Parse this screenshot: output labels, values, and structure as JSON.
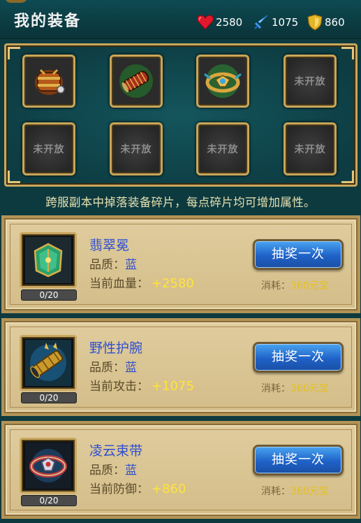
{
  "header": {
    "title": "我的装备",
    "stats": {
      "hp": "2580",
      "attack": "1075",
      "defense": "860"
    }
  },
  "equip_panel": {
    "slots": [
      {
        "state": "equipped",
        "icon": "chest-armor-icon"
      },
      {
        "state": "equipped",
        "icon": "bracer-icon"
      },
      {
        "state": "equipped",
        "icon": "belt-icon"
      },
      {
        "state": "locked",
        "label": "未开放"
      },
      {
        "state": "locked",
        "label": "未开放"
      },
      {
        "state": "locked",
        "label": "未开放"
      },
      {
        "state": "locked",
        "label": "未开放"
      },
      {
        "state": "locked",
        "label": "未开放"
      }
    ]
  },
  "info_text": "跨服副本中掉落装备碎片，每点碎片均可增加属性。",
  "cards": [
    {
      "name": "翡翠冕",
      "quality_label": "品质：",
      "quality_value": "蓝",
      "stat_label": "当前血量：",
      "stat_value": "+2580",
      "progress": "0/20",
      "button_label": "抽奖一次",
      "cost_label": "消耗：",
      "cost_value": "360元宝",
      "icon": "jade-crown-icon"
    },
    {
      "name": "野性护腕",
      "quality_label": "品质：",
      "quality_value": "蓝",
      "stat_label": "当前攻击：",
      "stat_value": "+1075",
      "progress": "0/20",
      "button_label": "抽奖一次",
      "cost_label": "消耗：",
      "cost_value": "360元宝",
      "icon": "wild-bracer-icon"
    },
    {
      "name": "凌云束带",
      "quality_label": "品质：",
      "quality_value": "蓝",
      "stat_label": "当前防御：",
      "stat_value": "+860",
      "progress": "0/20",
      "button_label": "抽奖一次",
      "cost_label": "消耗：",
      "cost_value": "360元宝",
      "icon": "cloud-belt-icon"
    }
  ],
  "colors": {
    "background": "#0d3a3f",
    "gold_frame": "#c9a65a",
    "card_bg": "#d8c391",
    "name_blue": "#2f4fd0",
    "stat_yellow": "#ffe43a",
    "button_blue": "#1f62c8"
  }
}
